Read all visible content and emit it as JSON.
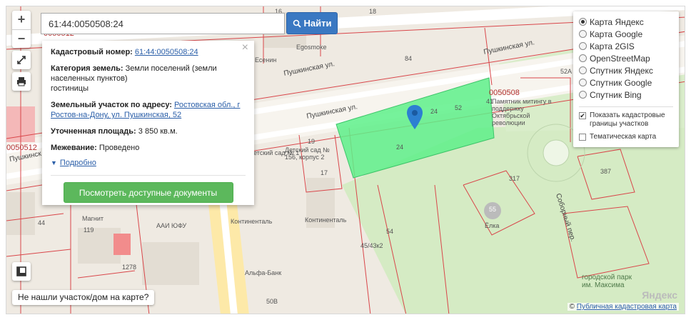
{
  "search": {
    "value": "61:44:0050508:24",
    "button_label": "Найти"
  },
  "info": {
    "cad_label": "Кадастровый номер:",
    "cad_value": "61:44:0050508:24",
    "category_label": "Категория земель:",
    "category_value": "Земли поселений (земли населенных пунктов)",
    "use_value": "гостиницы",
    "address_label": "Земельный участок по адресу:",
    "address_value": "Ростовская обл., г Ростов-на-Дону, ул. Пушкинская, 52",
    "area_label": "Уточненная площадь:",
    "area_value": "3 850 кв.м.",
    "survey_label": "Межевание:",
    "survey_value": "Проведено",
    "more_label": "Подробно",
    "docs_button": "Посмотреть доступные документы"
  },
  "layers": {
    "options": [
      {
        "label": "Карта Яндекс",
        "selected": true
      },
      {
        "label": "Карта Google",
        "selected": false
      },
      {
        "label": "Карта 2GIS",
        "selected": false
      },
      {
        "label": "OpenStreetMap",
        "selected": false
      },
      {
        "label": "Спутник Яндекс",
        "selected": false
      },
      {
        "label": "Спутник Google",
        "selected": false
      },
      {
        "label": "Спутник Bing",
        "selected": false
      }
    ],
    "checkboxes": [
      {
        "label": "Показать кадастровые границы участков",
        "checked": true
      },
      {
        "label": "Тематическая карта",
        "checked": false
      }
    ]
  },
  "not_found_label": "Не нашли участок/дом на карте?",
  "attribution": {
    "prefix": "©",
    "link": "Публичная кадастровая карта"
  },
  "yandex_logo": "Яндекс",
  "map_labels": {
    "street1": "Пушкинская ул.",
    "street2": "Пушкинская ул.",
    "street3": "Пушкинская ул.",
    "street_left": "Пушкинск",
    "sobor": "Соборный пер.",
    "quarter1": "0050512",
    "quarter2": "0050512",
    "quarter3": "0050508",
    "monument": "Памятник митингу в поддержку Октябрьской революции",
    "kindergarten": "Детский сад № 156, корпус 2",
    "kindergarten2": "Детский сад № 1",
    "kontinental1": "Континенталь",
    "kontinental2": "Континенталь",
    "magnit": "Магнит",
    "aai": "ААИ ЮФУ",
    "alfa": "Альфа-Банк",
    "elka": "Ёлка",
    "egosmoke": "Egosmoke",
    "esenin": "Есенин",
    "gorky": "городской парк им. Максима",
    "elka_num": "55",
    "plot_24a": "24",
    "plot_52": "52",
    "plot_24b": "24",
    "n84": "84",
    "n52a": "52А",
    "n387": "387",
    "n317": "317",
    "n54": "54",
    "n45": "45/43к2",
    "n119": "119",
    "n44": "44",
    "n1278": "1278",
    "n50b": "50В",
    "n16": "16",
    "n18": "18",
    "n19": "19",
    "n41": "41",
    "n17": "17"
  },
  "colors": {
    "parcel_fill": "#5ef08a",
    "boundary": "#d9464a",
    "marker": "#2d7fd1",
    "search_button": "#3a78c2",
    "docs_button": "#5cb85c"
  },
  "icons": [
    "plus-icon",
    "minus-icon",
    "fullscreen-icon",
    "print-icon",
    "ruler-icon",
    "search-icon",
    "map-marker-icon",
    "close-icon"
  ]
}
